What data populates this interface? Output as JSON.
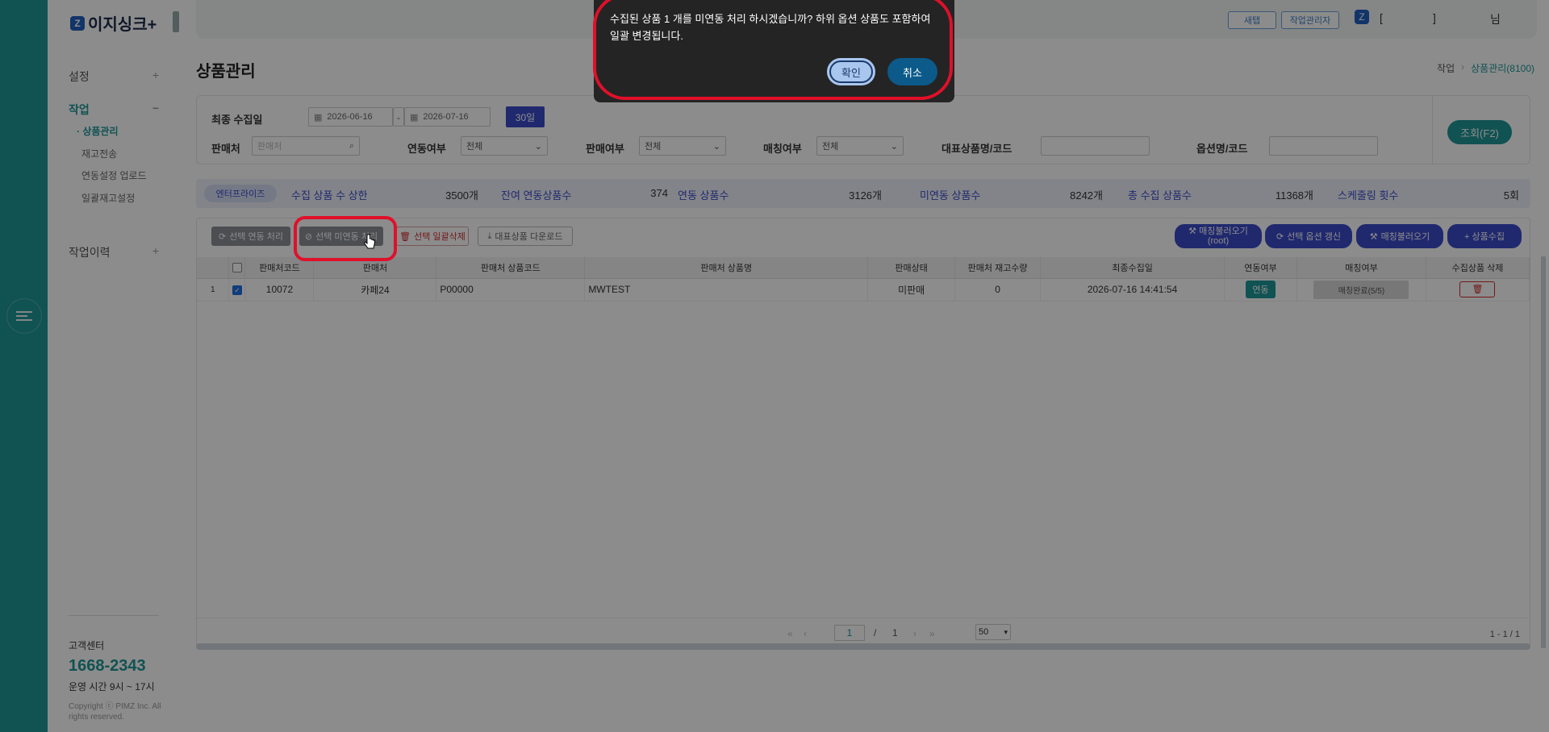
{
  "app": {
    "logo": "이지싱크+",
    "logo_mark": "Z"
  },
  "sidebar": {
    "items": [
      {
        "label": "설정",
        "toggle": "+"
      },
      {
        "label": "작업",
        "toggle": "−"
      },
      {
        "label": "작업이력",
        "toggle": "+"
      }
    ],
    "subitems": [
      "· 상품관리",
      "재고전송",
      "연동설정 업로드",
      "일괄재고설정"
    ],
    "cs_label": "고객센터",
    "cs_phone": "1668-2343",
    "cs_hours": "운영 시간 9시 ~ 17시",
    "copyright": "Copyright ⓒ PIMZ Inc. All rights reserved."
  },
  "topbar": {
    "btn_new": "새탭",
    "btn_manager": "작업관리자",
    "user_bracket_open": "[",
    "user_bracket_close": "]",
    "user_suffix": "님"
  },
  "page": {
    "title": "상품관리",
    "breadcrumb": [
      "작업",
      "상품관리(8100)"
    ],
    "breadcrumb_sep": "›"
  },
  "filters": {
    "date_label": "최종 수집일",
    "date_from": "2026-06-16",
    "date_to": "2026-07-16",
    "date_range_btn": "30일",
    "vendor_label": "판매처",
    "vendor_placeholder": "판매처",
    "link_label": "연동여부",
    "link_value": "전체",
    "sale_label": "판매여부",
    "sale_value": "전체",
    "match_label": "매칭여부",
    "match_value": "전체",
    "rep_label": "대표상품명/코드",
    "option_label": "옵션명/코드",
    "search_btn": "조회(F2)"
  },
  "stats": {
    "badge": "엔터프라이즈",
    "items": [
      {
        "label": "수집 상품 수 상한",
        "value": "3500개"
      },
      {
        "label": "잔여 연동상품수",
        "value": "374"
      },
      {
        "label": "연동 상품수",
        "value": "3126개"
      },
      {
        "label": "미연동 상품수",
        "value": "8242개"
      },
      {
        "label": "총 수집 상품수",
        "value": "11368개"
      },
      {
        "label": "스케줄링 횟수",
        "value": "5회"
      }
    ]
  },
  "toolbar": {
    "link_btn": "선택 연동 처리",
    "unlink_btn": "선택 미연동 처리",
    "delete_btn": "선택 일괄삭제",
    "download_btn": "대표상품 다운로드",
    "match_root_btn_line1": "매칭불러오기",
    "match_root_btn_line2": "(root)",
    "refresh_opt_btn": "선택 옵션 갱신",
    "match_btn": "매칭불러오기",
    "collect_btn": "+ 상품수집"
  },
  "grid": {
    "columns": [
      "",
      "",
      "판매처코드",
      "판매처",
      "판매처 상품코드",
      "판매처 상품명",
      "판매상태",
      "판매처 재고수량",
      "최종수집일",
      "연동여부",
      "매칭여부",
      "수집상품 삭제"
    ],
    "rows": [
      {
        "no": "1",
        "code": "10072",
        "vendor": "카페24",
        "product_code": "P00000",
        "product_name": "MWTEST",
        "status": "미판매",
        "stock": "0",
        "collected": "2026-07-16 14:41:54",
        "link": "연동",
        "match": "매칭완료(5/5)"
      }
    ]
  },
  "pager": {
    "current": "1",
    "sep": "/",
    "total": "1",
    "page_size": "50",
    "range": "1 - 1 / 1"
  },
  "dialog": {
    "message": "수집된 상품 1 개를 미연동 처리 하시겠습니까? 하위 옵션 상품도 포함하여 일괄 변경됩니다.",
    "ok": "확인",
    "cancel": "취소"
  },
  "colors": {
    "teal": "#1f9597",
    "indigo": "#3b4bc8",
    "highlight_red": "#e0102a"
  }
}
